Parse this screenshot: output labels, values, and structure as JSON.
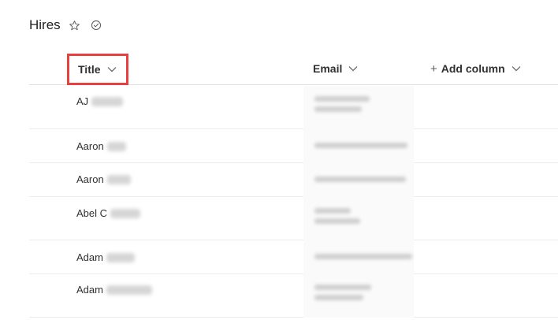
{
  "page": {
    "title": "Hires",
    "icons": [
      "star-outline-icon",
      "check-circle-icon"
    ]
  },
  "columns": {
    "title": "Title",
    "email": "Email",
    "add_column": "Add column",
    "add_icon": "+"
  },
  "rows": [
    {
      "title": "AJ"
    },
    {
      "title": "Aaron"
    },
    {
      "title": "Aaron"
    },
    {
      "title": "Abel C"
    },
    {
      "title": "Adam"
    },
    {
      "title": "Adam"
    }
  ],
  "colors": {
    "highlight": "#e6403f",
    "divider": "#edebe9"
  }
}
